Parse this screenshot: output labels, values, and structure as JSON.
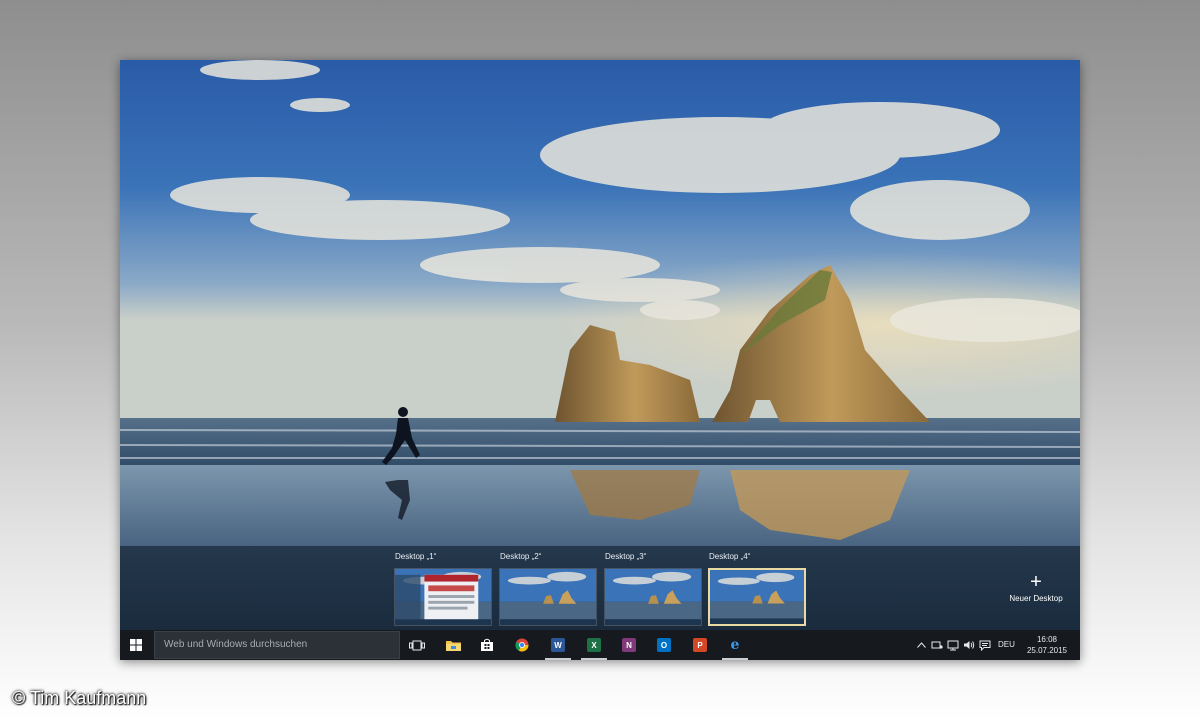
{
  "taskview": {
    "desktops": [
      {
        "label": "Desktop „1“",
        "active": false
      },
      {
        "label": "Desktop „2“",
        "active": false
      },
      {
        "label": "Desktop „3“",
        "active": false
      },
      {
        "label": "Desktop „4“",
        "active": true
      }
    ],
    "new_desktop_label": "Neuer Desktop"
  },
  "taskbar": {
    "search_placeholder": "Web und Windows durchsuchen",
    "pinned_apps": [
      {
        "name": "task-view-icon"
      },
      {
        "name": "file-explorer-icon"
      },
      {
        "name": "store-icon"
      },
      {
        "name": "chrome-icon"
      },
      {
        "name": "word-icon",
        "letter": "W",
        "color": "#2b5797",
        "running": true
      },
      {
        "name": "excel-icon",
        "letter": "X",
        "color": "#1e7145",
        "running": true
      },
      {
        "name": "onenote-icon",
        "letter": "N",
        "color": "#80397b"
      },
      {
        "name": "outlook-icon",
        "letter": "O",
        "color": "#0072c6"
      },
      {
        "name": "powerpoint-icon",
        "letter": "P",
        "color": "#d24726"
      },
      {
        "name": "edge-icon",
        "letter": "e",
        "color": "#1e88e5",
        "running": true
      }
    ],
    "tray": {
      "language": "DEU",
      "time": "16:08",
      "date": "25.07.2015"
    }
  },
  "credit": "© Tim Kaufmann"
}
